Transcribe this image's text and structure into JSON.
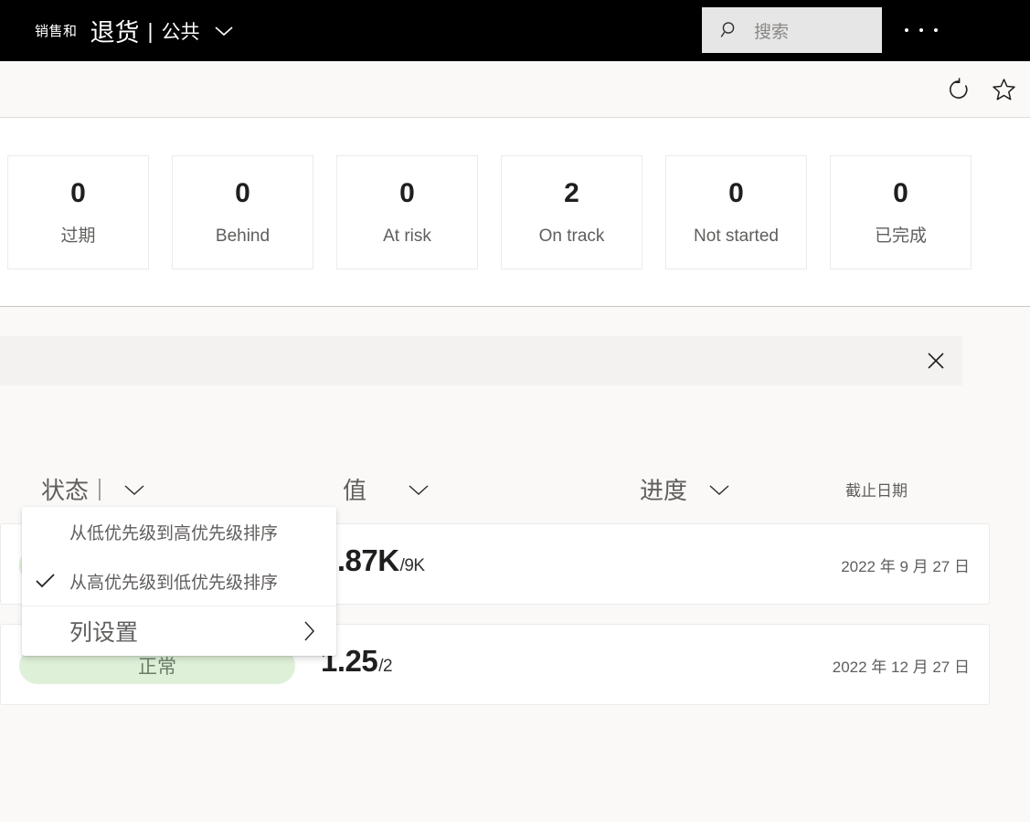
{
  "topbar": {
    "app_prefix": "销售和",
    "app_title": "退货",
    "separator": "|",
    "scope": "公共",
    "scope_chevron_icon": "chevron-down-icon",
    "search": {
      "icon": "search-icon",
      "placeholder": "搜索",
      "value": ""
    },
    "overflow_icon": "ellipsis-icon"
  },
  "commandbar": {
    "refresh_icon": "refresh-icon",
    "favorite_icon": "star-icon"
  },
  "stats": {
    "cards": [
      {
        "count": "0",
        "label": "过期"
      },
      {
        "count": "0",
        "label": "Behind"
      },
      {
        "count": "0",
        "label": "At risk"
      },
      {
        "count": "2",
        "label": "On track"
      },
      {
        "count": "0",
        "label": "Not started"
      },
      {
        "count": "0",
        "label": "已完成"
      }
    ]
  },
  "notice": {
    "text": "",
    "close_icon": "close-icon"
  },
  "table": {
    "columns": [
      {
        "label": "状态",
        "sorted": true,
        "chevron_icon": "chevron-down-icon"
      },
      {
        "label": "值",
        "sorted": false,
        "chevron_icon": "chevron-down-icon"
      },
      {
        "label": "进度",
        "sorted": false,
        "chevron_icon": "chevron-down-icon"
      },
      {
        "label": "截止日期",
        "sorted": false,
        "chevron_icon": ""
      }
    ],
    "rows": [
      {
        "status": "",
        "value": "7.87K",
        "target": "/9K",
        "due_date": "2022 年 9 月 27 日"
      },
      {
        "status": "正常",
        "value": "1.25",
        "target": "/2",
        "due_date": "2022 年 12 月 27 日"
      }
    ]
  },
  "context_menu": {
    "items": [
      {
        "label": "从低优先级到高优先级排序",
        "checked": false,
        "submenu": false
      },
      {
        "label": "从高优先级到低优先级排序",
        "checked": true,
        "submenu": false
      }
    ],
    "footer_item": {
      "label": "列设置",
      "submenu_icon": "chevron-right-icon"
    },
    "check_icon": "check-icon"
  },
  "colors": {
    "topbar_bg": "#000000",
    "page_bg": "#faf9f8",
    "card_bg": "#ffffff",
    "notice_bg": "#f3f2f1",
    "status_pill_bg": "#dff0d8",
    "status_pill_text": "#6b7c6b",
    "muted_text": "#605e5c"
  }
}
